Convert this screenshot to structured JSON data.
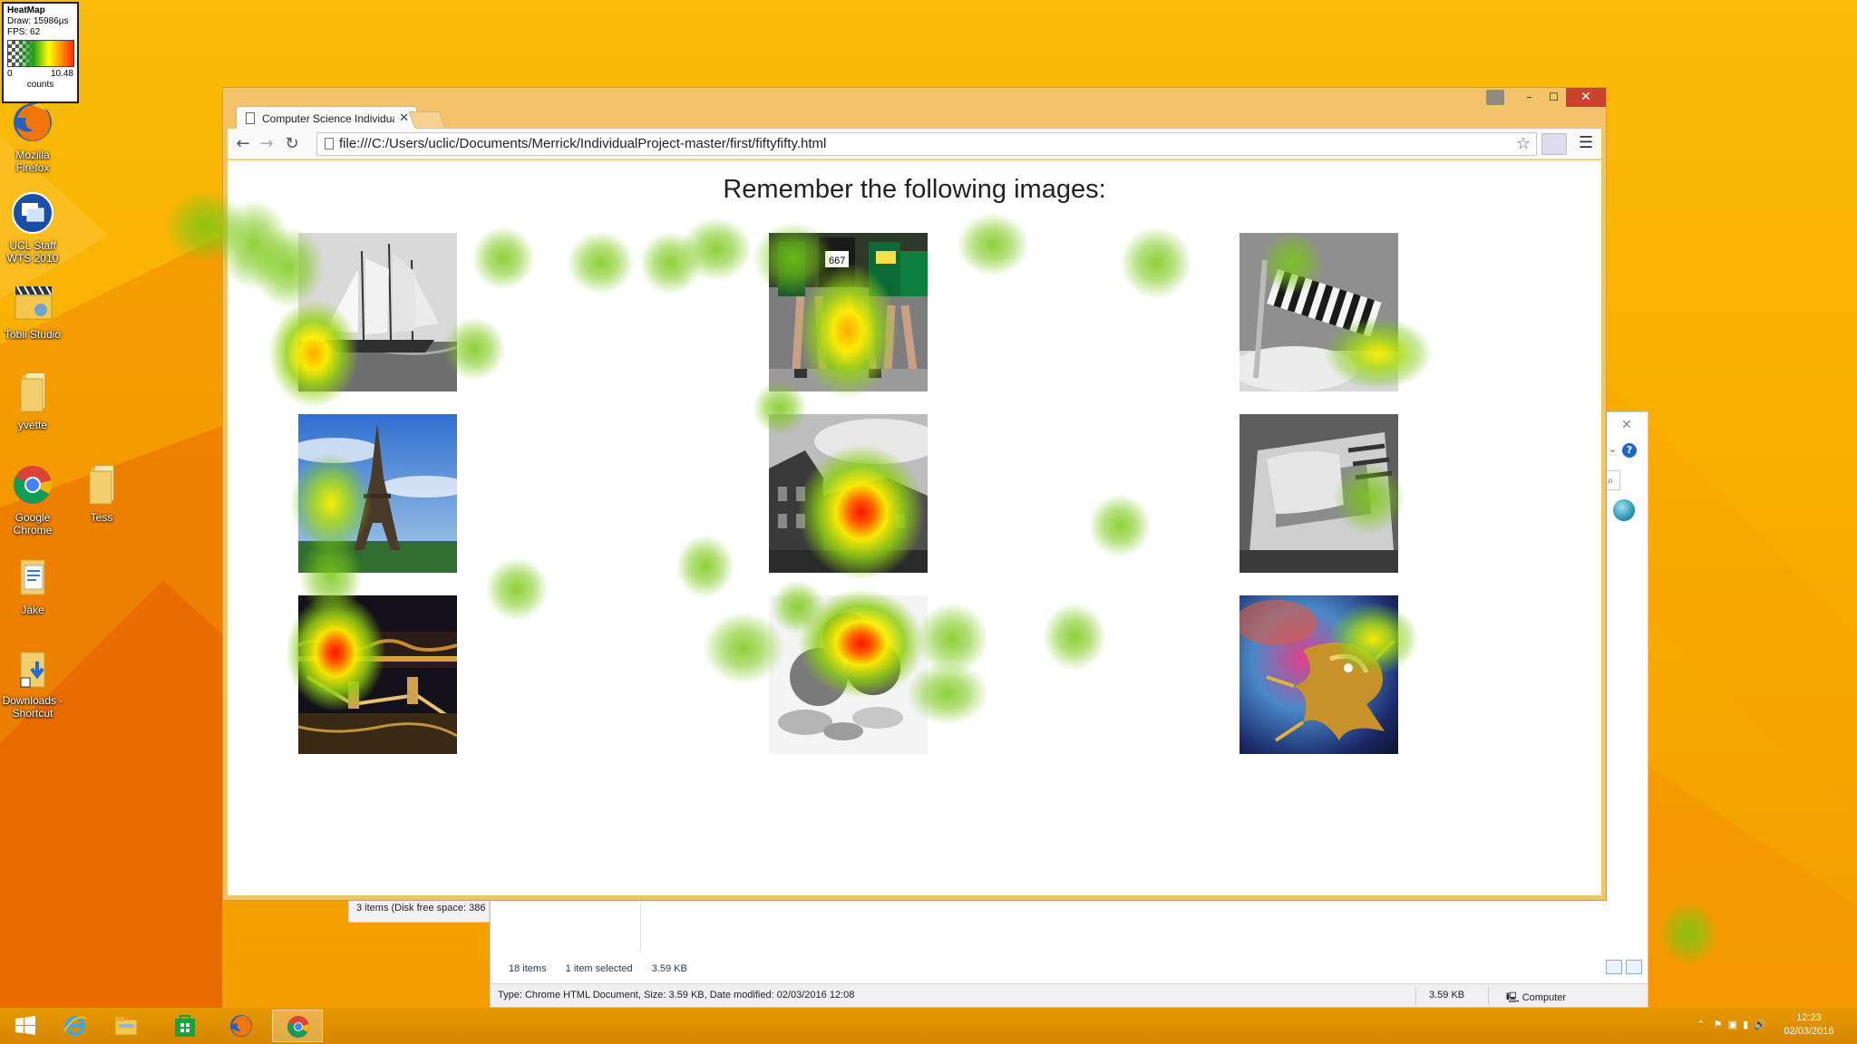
{
  "heatmap_legend": {
    "title": "HeatMap",
    "draw": "Draw: 15986µs",
    "fps": "FPS: 62",
    "min": "0",
    "max": "10.48",
    "unit": "counts"
  },
  "desktop_icons": [
    {
      "label": "Mozilla Firefox",
      "icon": "firefox-icon"
    },
    {
      "label": "UCL Staff WTS 2010",
      "icon": "remote-desktop-icon"
    },
    {
      "label": "Tobii Studio",
      "icon": "tobii-studio-icon"
    },
    {
      "label": "yvette",
      "icon": "folder-icon"
    },
    {
      "label": "Google Chrome",
      "icon": "chrome-icon"
    },
    {
      "label": "Tess",
      "icon": "folder-icon"
    },
    {
      "label": "Jake",
      "icon": "document-icon"
    },
    {
      "label": "Downloads - Shortcut",
      "icon": "downloads-folder-icon"
    }
  ],
  "browser": {
    "tab_title": "Computer Science Individual",
    "url": "file:///C:/Users/uclic/Documents/Merrick/IndividualProject-master/first/fiftyfifty.html",
    "heading": "Remember the following images:",
    "images": [
      {
        "subject": "sailing ship"
      },
      {
        "subject": "marathon runners"
      },
      {
        "subject": "striped windsock"
      },
      {
        "subject": "eiffel tower"
      },
      {
        "subject": "historic building"
      },
      {
        "subject": "toaster"
      },
      {
        "subject": "chain bridge at night"
      },
      {
        "subject": "fruits"
      },
      {
        "subject": "golden dragon"
      }
    ]
  },
  "explorer": {
    "status_items": "18 items",
    "status_selected": "1 item selected",
    "status_size": "3.59 KB",
    "details": "Type: Chrome HTML Document, Size: 3.59 KB, Date modified: 02/03/2016 12:08",
    "details_size": "3.59 KB",
    "details_location": "Computer",
    "left_status": "3 items (Disk free space: 386"
  },
  "taskbar": {
    "apps": [
      "start",
      "internet-explorer",
      "file-explorer",
      "store",
      "firefox",
      "chrome"
    ],
    "time": "12:23",
    "date": "02/03/2016"
  },
  "colors": {
    "desktop": "#f8ac00",
    "window_frame": "#f2c36a",
    "close_button": "#c7432d",
    "taskbar": "#e59800"
  }
}
